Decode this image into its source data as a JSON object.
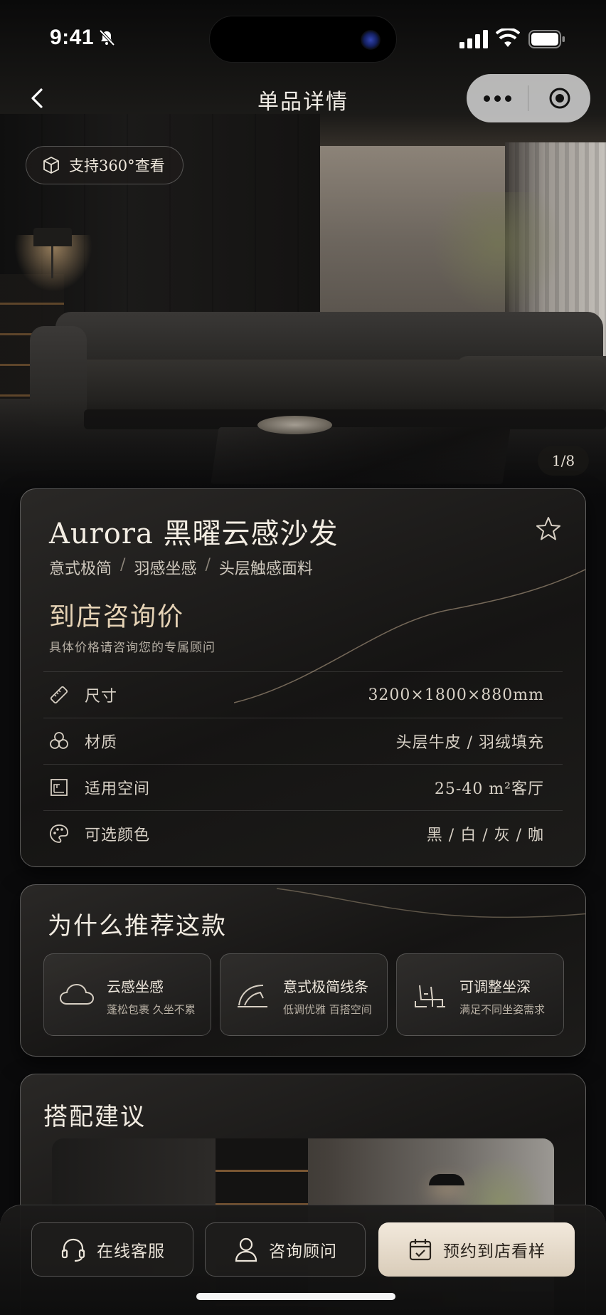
{
  "status_bar": {
    "time": "9:41"
  },
  "nav": {
    "title": "单品详情"
  },
  "hero": {
    "badge_label": "支持360°查看",
    "pager": "1/8"
  },
  "product": {
    "title": "Aurora 黑曜云感沙发",
    "tags": [
      "意式极简",
      "羽感坐感",
      "头层触感面料"
    ],
    "tag_separator": "/",
    "price": "到店咨询价",
    "price_note": "具体价格请咨询您的专属顾问",
    "specs": [
      {
        "icon": "ruler-icon",
        "label": "尺寸",
        "value": "3200×1800×880mm"
      },
      {
        "icon": "material-icon",
        "label": "材质",
        "value": "头层牛皮 / 羽绒填充"
      },
      {
        "icon": "room-icon",
        "label": "适用空间",
        "value": "25-40 m²客厅"
      },
      {
        "icon": "palette-icon",
        "label": "可选颜色",
        "value": "黑 / 白 / 灰 / 咖"
      }
    ]
  },
  "why": {
    "title": "为什么推荐这款",
    "features": [
      {
        "icon": "cloud-icon",
        "title": "云感坐感",
        "subtitle": "蓬松包裹 久坐不累"
      },
      {
        "icon": "curve-line-icon",
        "title": "意式极简线条",
        "subtitle": "低调优雅 百搭空间"
      },
      {
        "icon": "seat-adjust-icon",
        "title": "可调整坐深",
        "subtitle": "满足不同坐姿需求"
      }
    ]
  },
  "match": {
    "title": "搭配建议"
  },
  "bottom_bar": {
    "service_label": "在线客服",
    "advisor_label": "咨询顾问",
    "book_label": "预约到店看样"
  },
  "colors": {
    "accent": "#e6d3b6",
    "primary_button": "#ecdfcd",
    "background": "#0b0b0c"
  }
}
